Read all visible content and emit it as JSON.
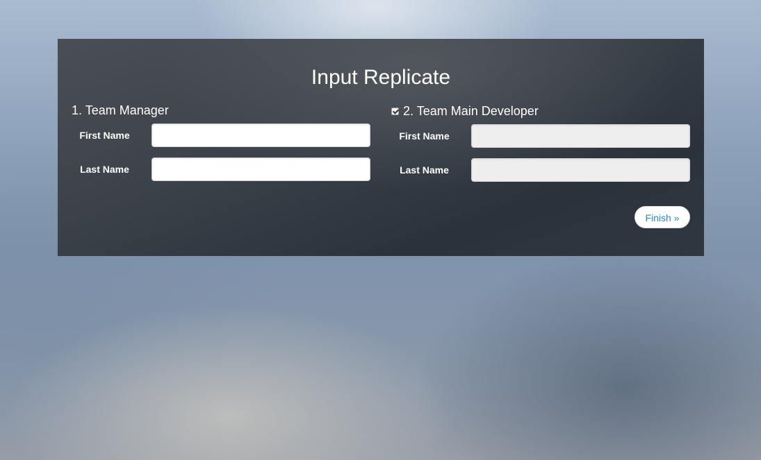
{
  "form": {
    "title": "Input Replicate",
    "sections": [
      {
        "heading": "1. Team Manager",
        "first_name_label": "First Name",
        "last_name_label": "Last Name",
        "first_name_value": "",
        "last_name_value": ""
      },
      {
        "heading": "2. Team Main Developer",
        "checkbox_checked": true,
        "first_name_label": "First Name",
        "last_name_label": "Last Name",
        "first_name_value": "",
        "last_name_value": "",
        "disabled": true
      }
    ],
    "finish_label": "Finish »"
  },
  "colors": {
    "panel": "#3a4048",
    "button_text": "#2a8ac5",
    "disabled_input": "#eeeeee"
  },
  "icons": {
    "section_2_checkbox": "checkbox-checked-icon"
  }
}
